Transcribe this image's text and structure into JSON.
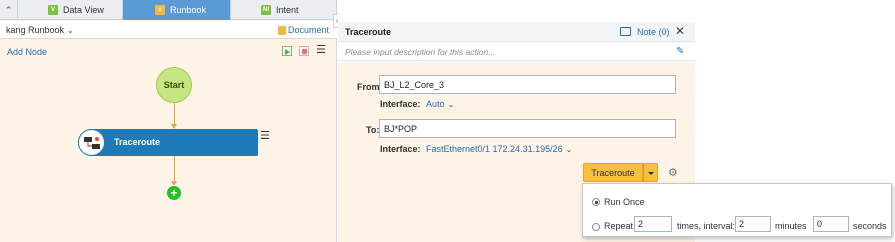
{
  "tabs": [
    {
      "label": "Data View",
      "icon": "V"
    },
    {
      "label": "Runbook",
      "icon": ""
    },
    {
      "label": "Intent",
      "icon": "NI"
    }
  ],
  "runbook": {
    "name": "kang Runbook",
    "doc_label": "Document",
    "add_node": "Add Node"
  },
  "flow": {
    "start": "Start",
    "node": "Traceroute"
  },
  "panel": {
    "title": "Traceroute",
    "note": "Note (0)",
    "description_placeholder": "Please input description for this action...",
    "from_label": "From:",
    "from_value": "BJ_L2_Core_3",
    "from_interface_label": "Interface:",
    "from_interface_value": "Auto",
    "to_label": "To:",
    "to_value": "BJ*POP",
    "to_interface_label": "Interface:",
    "to_interface_value": "FastEthernet0/1 172.24.31.195/26",
    "run_button": "Traceroute"
  },
  "run_options": {
    "run_once": "Run Once",
    "repeat": "Repeat",
    "repeat_count": "2",
    "times_interval": "times, interval:",
    "interval": "2",
    "minutes": "minutes",
    "seconds_value": "0",
    "seconds": "seconds"
  },
  "colors": {
    "active_tab": "#5b9bd5",
    "node": "#1f7ab8",
    "start": "#c6e77f",
    "run_button": "#f7bf42",
    "link": "#1f6fb5"
  }
}
